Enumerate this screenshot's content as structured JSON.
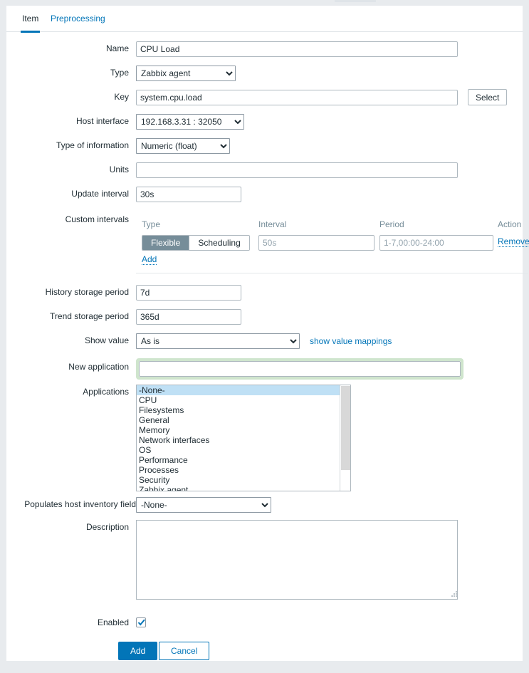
{
  "tabs": [
    {
      "label": "Item",
      "active": true
    },
    {
      "label": "Preprocessing",
      "active": false
    }
  ],
  "form": {
    "name": {
      "label": "Name",
      "value": "CPU Load"
    },
    "type": {
      "label": "Type",
      "value": "Zabbix agent"
    },
    "key": {
      "label": "Key",
      "value": "system.cpu.load",
      "select_button": "Select"
    },
    "host_interface": {
      "label": "Host interface",
      "value": "192.168.3.31 : 32050"
    },
    "type_of_info": {
      "label": "Type of information",
      "value": "Numeric (float)"
    },
    "units": {
      "label": "Units",
      "value": ""
    },
    "update_interval": {
      "label": "Update interval",
      "value": "30s"
    },
    "custom_intervals": {
      "label": "Custom intervals",
      "columns": [
        "Type",
        "Interval",
        "Period",
        "Action"
      ],
      "rows": [
        {
          "type_options": [
            "Flexible",
            "Scheduling"
          ],
          "type_selected": "Flexible",
          "interval_value": "",
          "interval_placeholder": "50s",
          "period_value": "",
          "period_placeholder": "1-7,00:00-24:00",
          "action": "Remove"
        }
      ],
      "add_label": "Add"
    },
    "history_storage": {
      "label": "History storage period",
      "value": "7d"
    },
    "trend_storage": {
      "label": "Trend storage period",
      "value": "365d"
    },
    "show_value": {
      "label": "Show value",
      "value": "As is",
      "link": "show value mappings"
    },
    "new_application": {
      "label": "New application",
      "value": "",
      "focused": true
    },
    "applications": {
      "label": "Applications",
      "options": [
        "-None-",
        "CPU",
        "Filesystems",
        "General",
        "Memory",
        "Network interfaces",
        "OS",
        "Performance",
        "Processes",
        "Security",
        "Zabbix agent"
      ],
      "selected": "-None-"
    },
    "host_inventory": {
      "label": "Populates host inventory field",
      "value": "-None-"
    },
    "description": {
      "label": "Description",
      "value": ""
    },
    "enabled": {
      "label": "Enabled",
      "checked": true
    }
  },
  "actions": {
    "submit": "Add",
    "cancel": "Cancel"
  },
  "colors": {
    "accent": "#0275b8",
    "toggle_selected_bg": "#768d99",
    "focus_ring": "#cfe5cd",
    "list_selected_bg": "#bfe0f5",
    "page_bg": "#e8ebee"
  }
}
